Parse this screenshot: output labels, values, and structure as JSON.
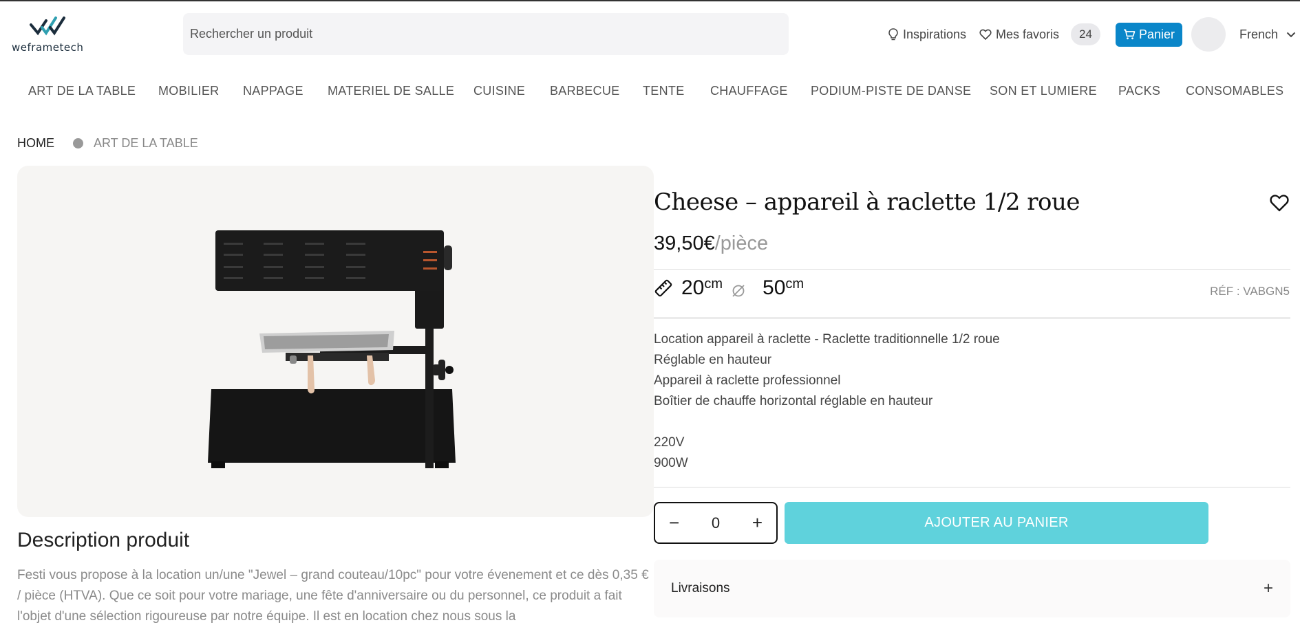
{
  "header": {
    "logo_text": "weframetech",
    "search_placeholder": "Rechercher un produit",
    "inspirations": "Inspirations",
    "favorites": "Mes favoris",
    "favorites_count": "24",
    "cart": "Panier",
    "language": "French"
  },
  "categories": [
    "ART DE LA TABLE",
    "MOBILIER",
    "NAPPAGE",
    "MATERIEL DE SALLE",
    "CUISINE",
    "BARBECUE",
    "TENTE",
    "CHAUFFAGE",
    "PODIUM-PISTE DE DANSE",
    "SON ET LUMIERE",
    "PACKS",
    "CONSOMABLES"
  ],
  "breadcrumb": {
    "home": "HOME",
    "current": "ART DE LA TABLE"
  },
  "product": {
    "title": "Cheese – appareil à raclette 1/2 roue",
    "price": "39,50€",
    "price_unit": "/pièce",
    "dim_length": "20",
    "dim_length_unit": "cm",
    "dim_diameter": "50",
    "dim_diameter_unit": "cm",
    "ref": "RÉF : VABGN5",
    "features": [
      "Location appareil à raclette - Raclette traditionnelle 1/2 roue",
      "Réglable en hauteur",
      "Appareil à raclette professionnel",
      "Boîtier de chauffe horizontal réglable en hauteur"
    ],
    "specs": [
      "220V",
      "900W"
    ],
    "quantity": "0",
    "add_to_cart": "AJOUTER AU PANIER"
  },
  "description": {
    "title": "Description produit",
    "body": "Festi vous propose à la location un/une \"Jewel – grand couteau/10pc\" pour votre évenement et ce dès 0,35 € / pièce (HTVA). Que ce soit pour votre mariage, une fête d'anniversaire ou du personnel, ce produit a fait l'objet d'une sélection rigoureuse par notre équipe. Il est en location chez nous sous la"
  },
  "accordion": {
    "livraisons": "Livraisons"
  },
  "colors": {
    "cart_button": "#0a86c9",
    "add_button": "#5fd2dc",
    "image_bg": "#f6f5f3"
  }
}
